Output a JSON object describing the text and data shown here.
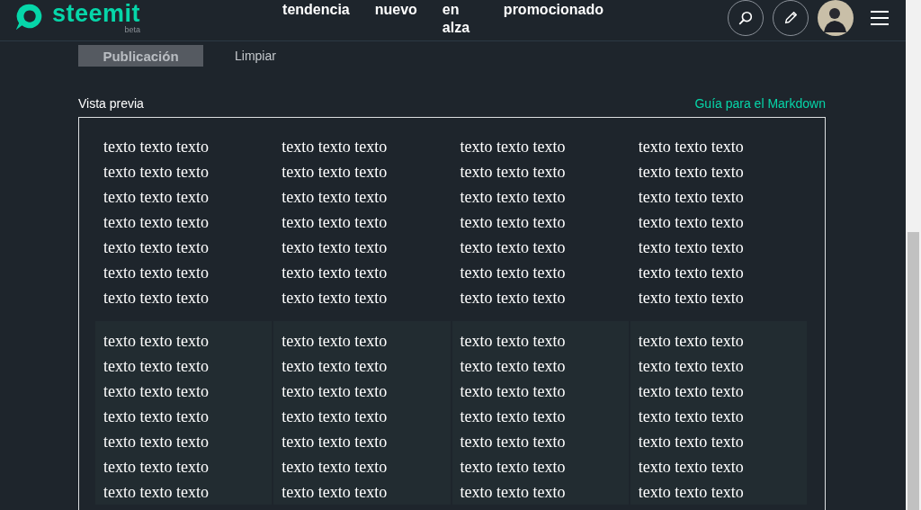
{
  "header": {
    "logo": {
      "name": "steemit",
      "tag": "beta"
    },
    "nav": [
      "tendencia",
      "nuevo",
      "en alza",
      "promocionado"
    ]
  },
  "editor": {
    "buttons": [
      {
        "label": "Publicación",
        "kind": "primary",
        "disabled": true
      },
      {
        "label": "Limpiar",
        "kind": "link",
        "disabled": false
      }
    ]
  },
  "preview": {
    "title": "Vista previa",
    "guide_link": "Guía para el Markdown",
    "tables": [
      {
        "shaded": false,
        "rows": [
          [
            "texto texto texto",
            "texto texto texto",
            "texto texto texto",
            "texto texto texto"
          ],
          [
            "texto texto texto",
            "texto texto texto",
            "texto texto texto",
            "texto texto texto"
          ],
          [
            "texto texto texto",
            "texto texto texto",
            "texto texto texto",
            "texto texto texto"
          ],
          [
            "texto texto texto",
            "texto texto texto",
            "texto texto texto",
            "texto texto texto"
          ],
          [
            "texto texto texto",
            "texto texto texto",
            "texto texto texto",
            "texto texto texto"
          ],
          [
            "texto texto texto",
            "texto texto texto",
            "texto texto texto",
            "texto texto texto"
          ],
          [
            "texto texto texto",
            "texto texto texto",
            "texto texto texto",
            "texto texto texto"
          ]
        ]
      },
      {
        "shaded": true,
        "rows": [
          [
            "texto texto texto",
            "texto texto texto",
            "texto texto texto",
            "texto texto texto"
          ],
          [
            "texto texto texto",
            "texto texto texto",
            "texto texto texto",
            "texto texto texto"
          ],
          [
            "texto texto texto",
            "texto texto texto",
            "texto texto texto",
            "texto texto texto"
          ],
          [
            "texto texto texto",
            "texto texto texto",
            "texto texto texto",
            "texto texto texto"
          ],
          [
            "texto texto texto",
            "texto texto texto",
            "texto texto texto",
            "texto texto texto"
          ],
          [
            "texto texto texto",
            "texto texto texto",
            "texto texto texto",
            "texto texto texto"
          ],
          [
            "texto texto texto",
            "texto texto texto",
            "texto texto texto",
            "texto texto texto"
          ]
        ]
      }
    ]
  }
}
